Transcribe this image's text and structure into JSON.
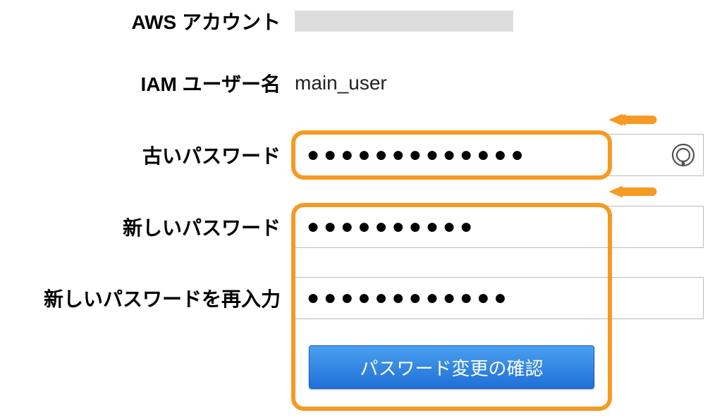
{
  "labels": {
    "account": "AWS アカウント",
    "iam_user": "IAM ユーザー名",
    "old_password": "古いパスワード",
    "new_password": "新しいパスワード",
    "retype_password": "新しいパスワードを再入力"
  },
  "values": {
    "iam_user": "main_user",
    "old_password": "●●●●●●●●●●●●●",
    "new_password": "●●●●●●●●●●",
    "retype_password": "●●●●●●●●●●●●"
  },
  "buttons": {
    "submit": "パスワード変更の確認"
  },
  "annotations": {
    "arrow1_target": "old-password-input",
    "arrow2_target": "new-password-section",
    "highlight1_target": "old-password-input",
    "highlight2_target": "new-password-section"
  }
}
